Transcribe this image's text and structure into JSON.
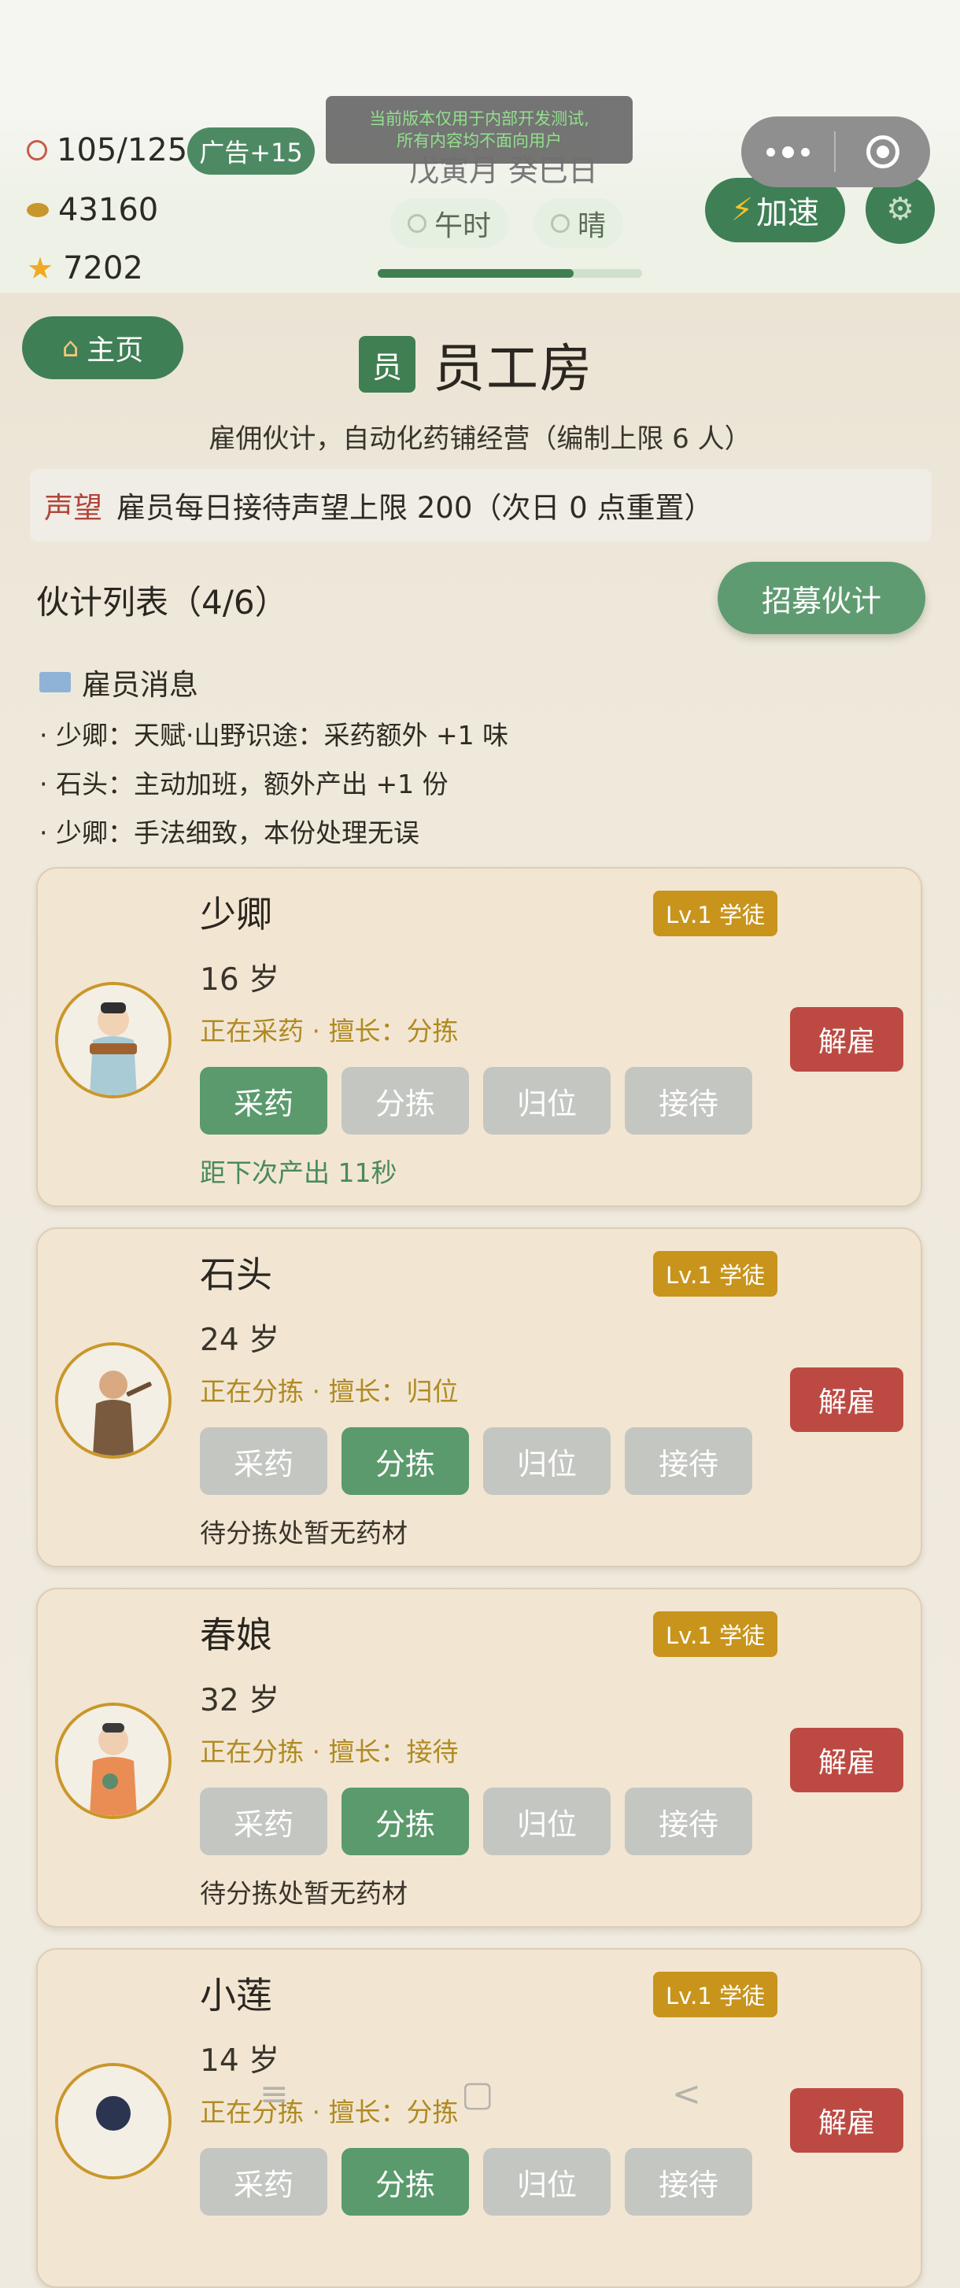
{
  "stats": {
    "stamina": "105/125",
    "ad_bonus": "广告+15",
    "coins": "43160",
    "stars": "7202"
  },
  "notice": {
    "line1": "当前版本仅用于内部开发测试,",
    "line2": "所有内容均不面向用户"
  },
  "time_info": {
    "date": "戊寅月 癸巳日",
    "hour": "午时",
    "weather": "晴",
    "day_progress": 0.74
  },
  "controls": {
    "speed_label": "加速"
  },
  "home": {
    "label": "主页"
  },
  "page": {
    "badge": "员",
    "title": "员工房",
    "subtitle": "雇佣伙计，自动化药铺经营（编制上限 6 人）"
  },
  "reputation": {
    "tag": "声望",
    "text": "雇员每日接待声望上限 200（次日 0 点重置）"
  },
  "list": {
    "title": "伙计列表（4/6）",
    "recruit_label": "招募伙计"
  },
  "messages": {
    "title": "雇员消息",
    "items": [
      "· 少卿：天赋·山野识途：采药额外 +1 味",
      "· 石头：主动加班，额外产出 +1 份",
      "· 少卿：手法细致，本份处理无误"
    ]
  },
  "task_labels": [
    "采药",
    "分拣",
    "归位",
    "接待"
  ],
  "employees": [
    {
      "name": "少卿",
      "age": "16 岁",
      "status": "正在采药 · 擅长：分拣",
      "level": "Lv.1 学徒",
      "fire": "解雇",
      "active_task": 0,
      "note": "距下次产出 11秒",
      "note_color": "#4a8a5c"
    },
    {
      "name": "石头",
      "age": "24 岁",
      "status": "正在分拣 · 擅长：归位",
      "level": "Lv.1 学徒",
      "fire": "解雇",
      "active_task": 1,
      "note": "待分拣处暂无药材",
      "note_color": "#3a352c"
    },
    {
      "name": "春娘",
      "age": "32 岁",
      "status": "正在分拣 · 擅长：接待",
      "level": "Lv.1 学徒",
      "fire": "解雇",
      "active_task": 1,
      "note": "待分拣处暂无药材",
      "note_color": "#3a352c"
    },
    {
      "name": "小莲",
      "age": "14 岁",
      "status": "正在分拣 · 擅长：分拣",
      "level": "Lv.1 学徒",
      "fire": "解雇",
      "active_task": 1,
      "note": "",
      "note_color": "#3a352c"
    }
  ],
  "colors": {
    "primary_green": "#3f7f52",
    "gold": "#c8941c",
    "danger": "#bc4a43"
  }
}
